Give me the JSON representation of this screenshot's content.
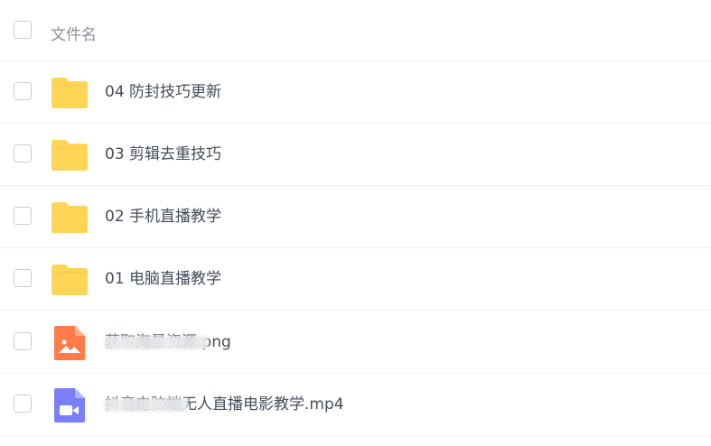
{
  "header": {
    "column_label": "文件名"
  },
  "files": [
    {
      "name": "04 防封技巧更新",
      "type": "folder",
      "icon": "folder-icon"
    },
    {
      "name": "03 剪辑去重技巧",
      "type": "folder",
      "icon": "folder-icon"
    },
    {
      "name": "02 手机直播教学",
      "type": "folder",
      "icon": "folder-icon"
    },
    {
      "name": "01 电脑直播教学",
      "type": "folder",
      "icon": "folder-icon"
    },
    {
      "name": "获取海量资源.png",
      "type": "image",
      "icon": "image-file-icon",
      "accent": "#ff7b47"
    },
    {
      "name": "抖音电脑端无人直播电影教学.mp4",
      "type": "video",
      "icon": "video-file-icon",
      "accent": "#7b7ff7"
    }
  ],
  "colors": {
    "folder": "#ffd557",
    "image": "#ff7b47",
    "video": "#7b7ff7",
    "divider": "#f1f2f4"
  }
}
